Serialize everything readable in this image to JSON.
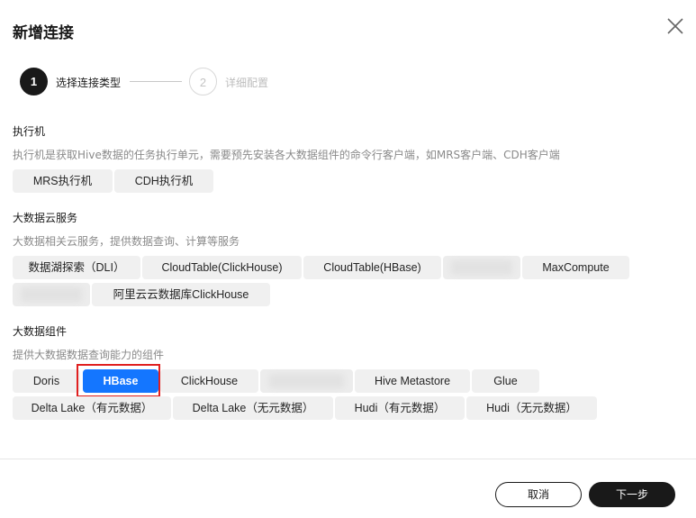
{
  "dialog": {
    "title": "新增连接"
  },
  "steps": [
    {
      "number": "1",
      "label": "选择连接类型"
    },
    {
      "number": "2",
      "label": "详细配置"
    }
  ],
  "sections": {
    "executor": {
      "title": "执行机",
      "description": "执行机是获取Hive数据的任务执行单元，需要预先安装各大数据组件的命令行客户端，如MRS客户端、CDH客户端",
      "options": [
        "MRS执行机",
        "CDH执行机"
      ]
    },
    "cloud": {
      "title": "大数据云服务",
      "description": "大数据相关云服务，提供数据查询、计算等服务",
      "options": [
        "数据湖探索（DLI）",
        "CloudTable(ClickHouse)",
        "CloudTable(HBase)",
        "",
        "MaxCompute",
        "",
        "阿里云云数据库ClickHouse"
      ]
    },
    "components": {
      "title": "大数据组件",
      "description": "提供大数据数据查询能力的组件",
      "options": [
        "Doris",
        "HBase",
        "ClickHouse",
        "",
        "Hive Metastore",
        "Glue",
        "Delta Lake（有元数据）",
        "Delta Lake（无元数据）",
        "Hudi（有元数据）",
        "Hudi（无元数据）"
      ],
      "selected": "HBase"
    }
  },
  "footer": {
    "cancel_label": "取消",
    "next_label": "下一步"
  },
  "colors": {
    "selected": "#1476ff",
    "highlight_outline": "#e02020",
    "primary_dark": "#191919"
  }
}
